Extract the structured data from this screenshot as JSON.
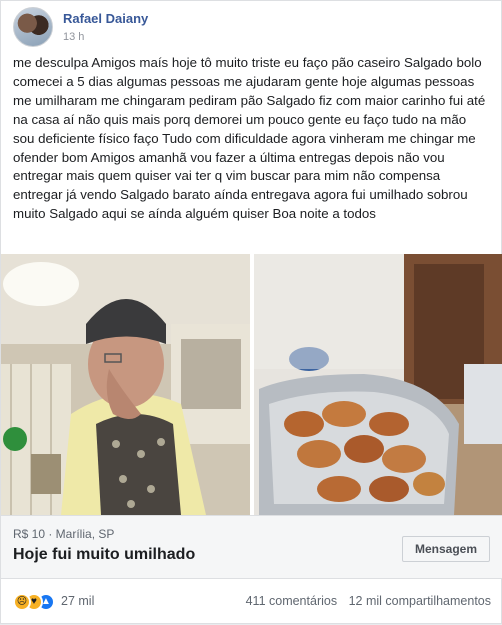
{
  "post": {
    "author": "Rafael Daiany",
    "time": "13 h",
    "text": "me desculpa Amigos maís hoje tô muito triste eu faço pão caseiro Salgado bolo comecei a 5 dias algumas pessoas me ajudaram gente hoje algumas pessoas me umilharam me chingaram pediram pão Salgado fiz com maior carinho fui até na casa aí não quis mais porq demorei um pouco gente eu faço tudo na mão sou deficiente físico faço Tudo com dificuldade agora vinheram me chingar me ofender bom Amigos amanhã vou fazer a última entregas depois não vou entregar mais quem quiser vai ter q vim buscar para mim não compensa entregar já vendo Salgado barato aínda entregava agora fui umilhado sobrou muito Salgado aqui se aínda alguém quiser Boa noite a todos"
  },
  "listing": {
    "price_location": "R$ 10 · Marília, SP",
    "title": "Hoje fui muito umilhado",
    "message_button": "Mensagem"
  },
  "footer": {
    "reaction_count": "27 mil",
    "comments": "411 comentários",
    "shares": "12 mil compartilhamentos"
  },
  "icons": [
    "sad-reaction-icon",
    "care-reaction-icon",
    "like-reaction-icon"
  ]
}
